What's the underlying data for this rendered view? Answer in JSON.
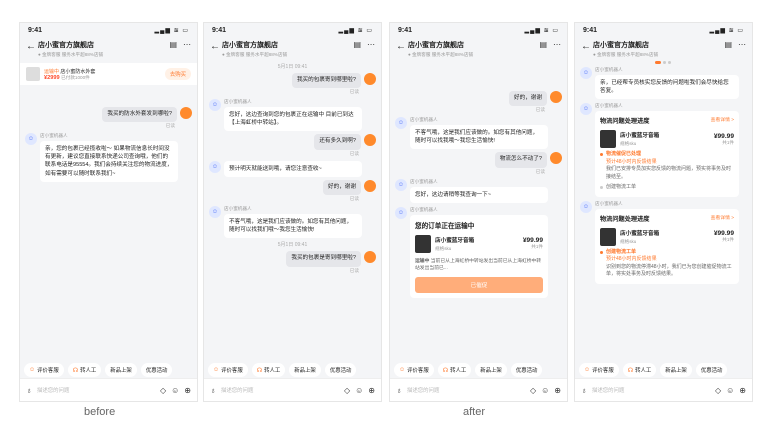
{
  "status": {
    "time": "9:41",
    "signal": "▂▄▆ ≋ ▭"
  },
  "header": {
    "title": "店小蜜官方旗舰店",
    "subtitle": "● 金牌客服   服务水平超88%店铺",
    "icons": [
      "store-icon",
      "more-icon"
    ]
  },
  "product_bar": {
    "tag": "运输中",
    "title": "店小蜜防水外套",
    "price": "¥2999",
    "meta": "已付款1000件",
    "cart": "去购买"
  },
  "screens": {
    "before": {
      "user_q": "我买的防水外套发到哪啦?",
      "read": "已读",
      "bot_name": "店小蜜机器人",
      "bot_reply": "亲，您的包裹已经揽收啦～ 如果物流信息长时间没有更新，建议您直接联系快递公司查询哦，他们的联系电话是95554。我们会持续关注您的物流进度，如有需要可以随时联系我们~"
    },
    "screen2": {
      "time1": "5月1日 09:41",
      "q1": "我买的包裹寄到哪里啦?",
      "r1": "已读",
      "bot_name": "店小蜜机器人",
      "a1": "您好，这边查询到您的包裹正在运输中 目前已到达【上海虹桥中转站】。",
      "q2": "还有多久到啊?",
      "r2": "已读",
      "a2": "预计明天就能送到哦，请您注意查收~",
      "q3": "好的，谢谢",
      "r3": "已读",
      "a3": "不客气哦，这是我们应该做的。如您有其他问题，随时可以找我们哦～我您生活愉快!",
      "time2": "5月1日 09:41",
      "q4": "我买的包裹是寄到哪里啦?",
      "r4": "已读"
    },
    "after": {
      "q1": "好的，谢谢",
      "r1": "已读",
      "bot_name": "店小蜜机器人",
      "a1": "不客气哦，这是我们应该做的。如您有其他问题，随时可以找我哦～我您生活愉快!",
      "q2": "物流怎么不动了?",
      "r2": "已读",
      "a2": "您好，这边请稍等我查询一下~",
      "order": {
        "title": "您的订单正在运输中",
        "product": "店小蜜蓝牙音箱",
        "sku": "规格sku",
        "price": "¥99.99",
        "count": "共1件",
        "line_label": "运输中",
        "line_text": "当前已从上海虹桥中转站发出当前已从上海虹桥中转站发出当前已...",
        "button": "已催促"
      }
    },
    "screen4": {
      "bot_name": "店小蜜机器人",
      "a1": "亲，已经帮专员核实您反馈的问题啦我们会尽快给您答复。",
      "logi1": {
        "title": "物流问题处理进度",
        "link": "查看详情 >",
        "product": "店小蜜蓝牙音箱",
        "sku": "规格sku",
        "price": "¥99.99",
        "count": "共1件",
        "s1": "物流催促已处理",
        "s1b": "预计48小时内反馈结果",
        "s1c": "我们已安排专员加实您反馈的物流问题，预实将事务及时接结至。",
        "s2": "创建物流工单"
      },
      "logi2": {
        "title": "物流问题处理进度",
        "link": "查看详情 >",
        "product": "店小蜜蓝牙音箱",
        "sku": "规格sku",
        "price": "¥99.99",
        "count": "共1件",
        "s1": "创建物流工单",
        "s1b": "预计48小时内反馈结果",
        "s1c": "识别到您的物流停滞48小时，我们已为您创建催促物流工单，将实处事务及时反馈结果。"
      }
    }
  },
  "shortcuts": [
    "评价客服",
    "转人工",
    "新品上架",
    "优惠活动"
  ],
  "input_placeholder": "描述您的问题",
  "captions": {
    "before": "before",
    "after": "after"
  }
}
